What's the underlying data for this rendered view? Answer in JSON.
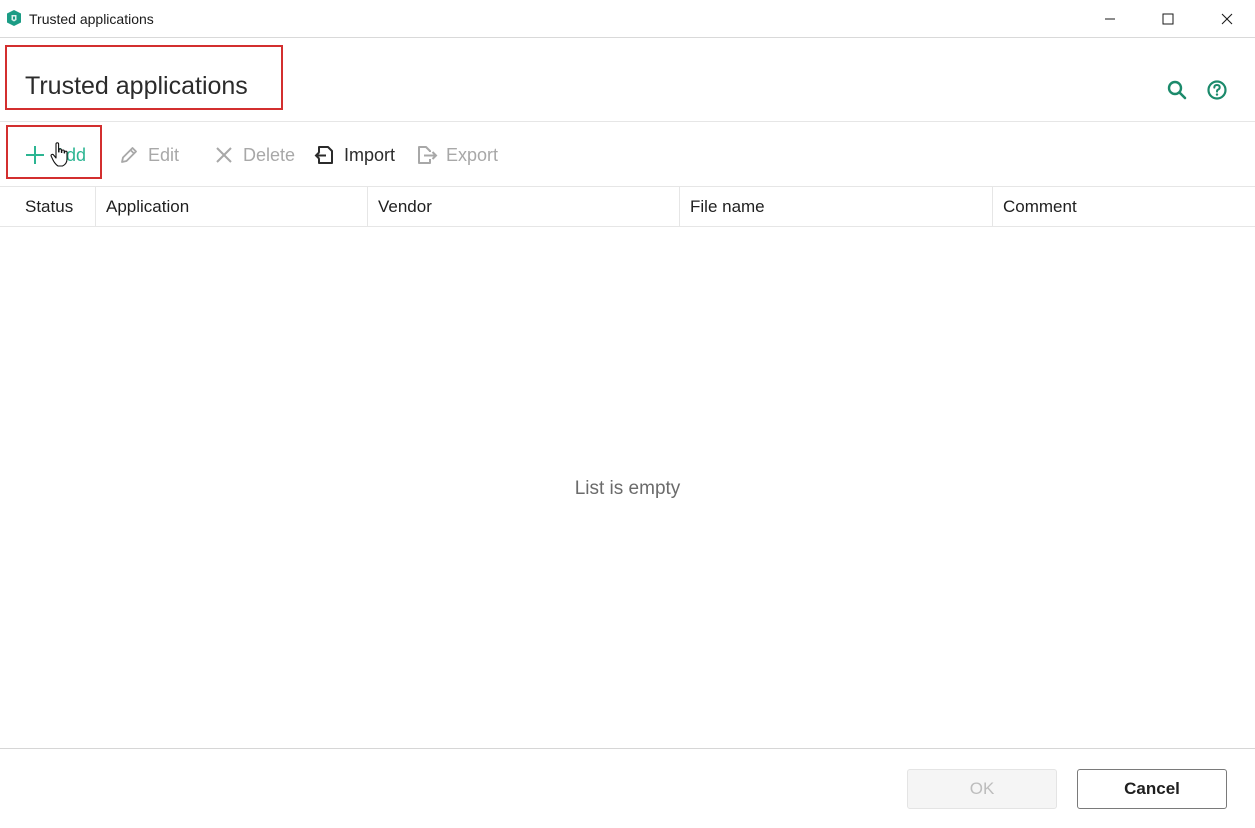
{
  "window": {
    "title": "Trusted applications",
    "icon": "kaspersky-shield-icon"
  },
  "header": {
    "title": "Trusted applications",
    "search_icon": "search-icon",
    "help_icon": "help-icon"
  },
  "toolbar": {
    "add_label": "Add",
    "edit_label": "Edit",
    "delete_label": "Delete",
    "import_label": "Import",
    "export_label": "Export"
  },
  "table": {
    "columns": [
      "Status",
      "Application",
      "Vendor",
      "File name",
      "Comment"
    ],
    "empty_message": "List is empty"
  },
  "footer": {
    "ok_label": "OK",
    "cancel_label": "Cancel"
  },
  "colors": {
    "accent": "#2cb592",
    "highlight": "#d32f2f",
    "disabled": "#a8a8a8"
  }
}
